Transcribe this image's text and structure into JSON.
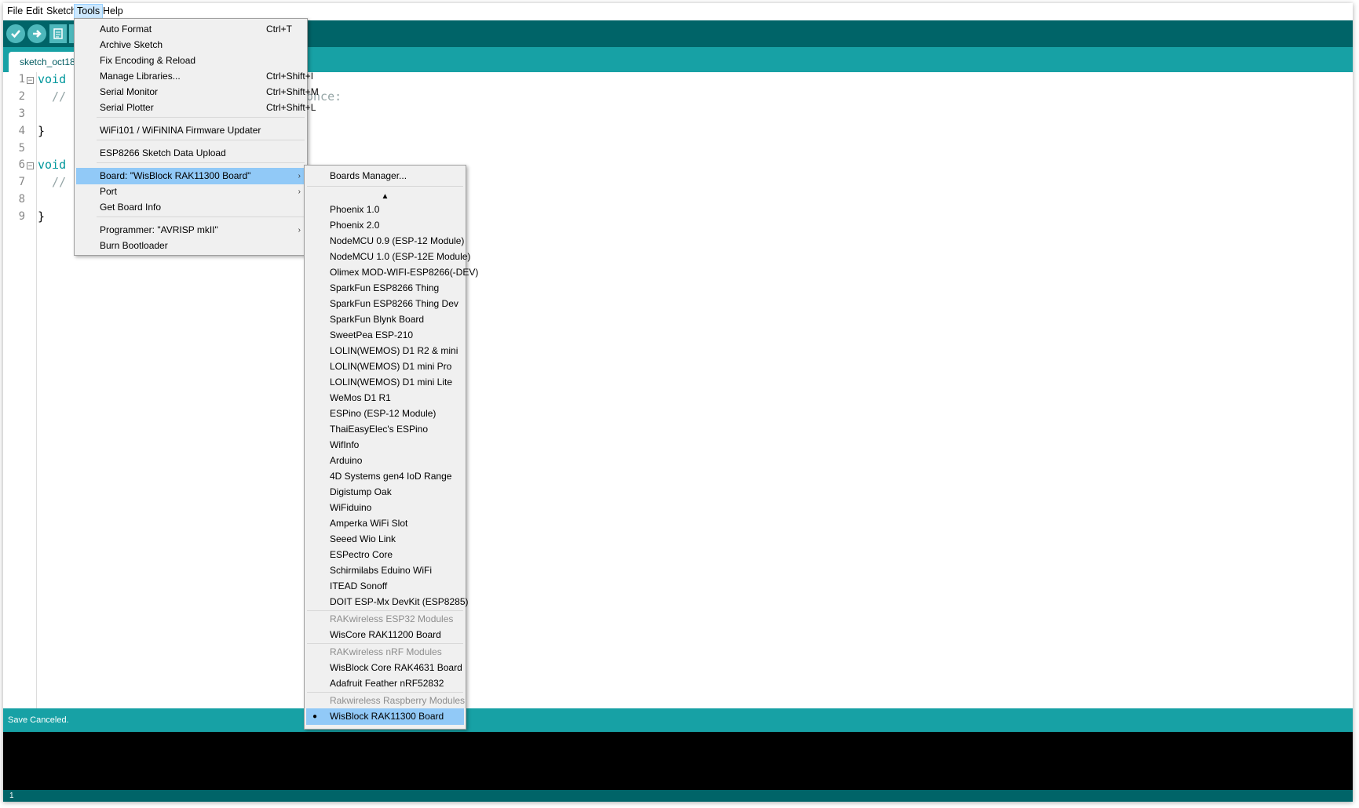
{
  "menubar": {
    "items": [
      "File",
      "Edit",
      "Sketch",
      "Tools",
      "Help"
    ],
    "active": "Tools"
  },
  "toolbar": {
    "buttons": [
      "verify-button",
      "upload-button",
      "new-button"
    ]
  },
  "tabs": [
    {
      "label": "sketch_oct18a"
    }
  ],
  "editor": {
    "line_numbers": [
      "1",
      "2",
      "3",
      "4",
      "5",
      "6",
      "7",
      "8",
      "9"
    ],
    "lines": [
      {
        "kw": "void s",
        "rest": ""
      },
      {
        "kw": "",
        "rest": "  // p"
      },
      {
        "kw": "",
        "rest": ""
      },
      {
        "kw": "",
        "rest": "}"
      },
      {
        "kw": "",
        "rest": ""
      },
      {
        "kw": "void l",
        "rest": ""
      },
      {
        "kw": "",
        "rest": "  // p"
      },
      {
        "kw": "",
        "rest": ""
      },
      {
        "kw": "",
        "rest": "}"
      }
    ],
    "visible_fragment": "once:"
  },
  "tools_menu": {
    "items": [
      {
        "label": "Auto Format",
        "shortcut": "Ctrl+T"
      },
      {
        "label": "Archive Sketch",
        "shortcut": ""
      },
      {
        "label": "Fix Encoding & Reload",
        "shortcut": ""
      },
      {
        "label": "Manage Libraries...",
        "shortcut": "Ctrl+Shift+I"
      },
      {
        "label": "Serial Monitor",
        "shortcut": "Ctrl+Shift+M"
      },
      {
        "label": "Serial Plotter",
        "shortcut": "Ctrl+Shift+L"
      },
      {
        "label": "WiFi101 / WiFiNINA Firmware Updater",
        "shortcut": ""
      },
      {
        "label": "ESP8266 Sketch Data Upload",
        "shortcut": ""
      },
      {
        "label": "Board: \"WisBlock RAK11300 Board\"",
        "shortcut": ""
      },
      {
        "label": "Port",
        "shortcut": ""
      },
      {
        "label": "Get Board Info",
        "shortcut": ""
      },
      {
        "label": "Programmer: \"AVRISP mkII\"",
        "shortcut": ""
      },
      {
        "label": "Burn Bootloader",
        "shortcut": ""
      }
    ],
    "arrow": "›"
  },
  "board_menu": {
    "manager": "Boards Manager...",
    "scroll_up": "▲",
    "boards": [
      "Phoenix 1.0",
      "Phoenix 2.0",
      "NodeMCU 0.9 (ESP-12 Module)",
      "NodeMCU 1.0 (ESP-12E Module)",
      "Olimex MOD-WIFI-ESP8266(-DEV)",
      "SparkFun ESP8266 Thing",
      "SparkFun ESP8266 Thing Dev",
      "SparkFun Blynk Board",
      "SweetPea ESP-210",
      "LOLIN(WEMOS) D1 R2 & mini",
      "LOLIN(WEMOS) D1 mini Pro",
      "LOLIN(WEMOS) D1 mini Lite",
      "WeMos D1 R1",
      "ESPino (ESP-12 Module)",
      "ThaiEasyElec's ESPino",
      "WifInfo",
      "Arduino",
      "4D Systems gen4 IoD Range",
      "Digistump Oak",
      "WiFiduino",
      "Amperka WiFi Slot",
      "Seeed Wio Link",
      "ESPectro Core",
      "Schirmilabs Eduino WiFi",
      "ITEAD Sonoff",
      "DOIT ESP-Mx DevKit (ESP8285)"
    ],
    "groups": [
      {
        "header": "RAKwireless ESP32 Modules",
        "items": [
          "WisCore RAK11200 Board"
        ]
      },
      {
        "header": "RAKwireless nRF Modules",
        "items": [
          "WisBlock Core RAK4631 Board",
          "Adafruit Feather nRF52832"
        ]
      },
      {
        "header": "Rakwireless Raspberry Modules",
        "items": [
          "WisBlock RAK11300 Board"
        ]
      }
    ],
    "selected": "WisBlock RAK11300 Board",
    "bullet": "●"
  },
  "status": {
    "message": "Save Canceled."
  },
  "bottom": {
    "line": "1"
  }
}
